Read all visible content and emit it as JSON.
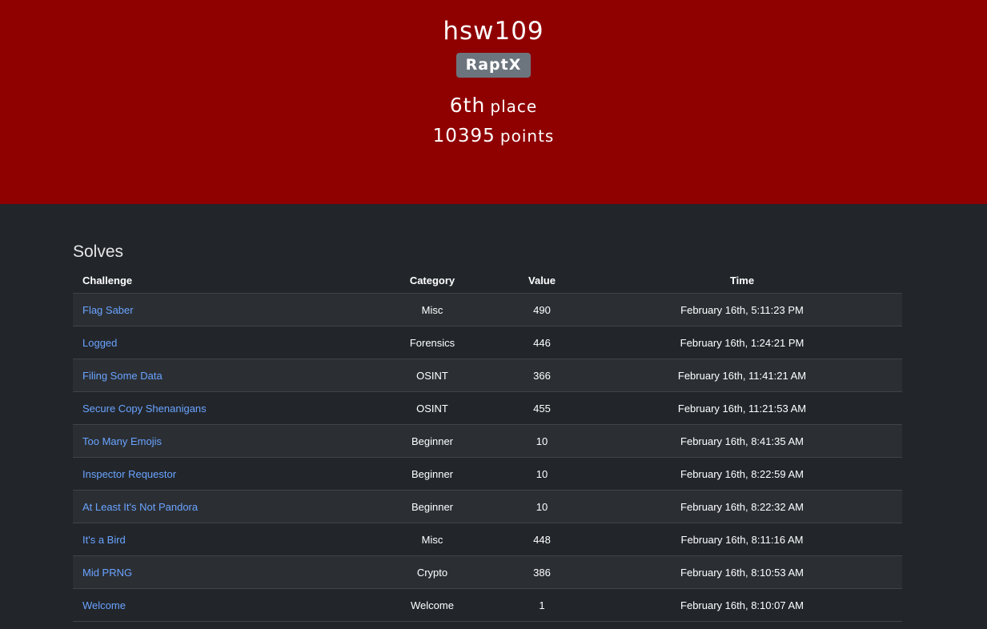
{
  "user": {
    "name": "hsw109",
    "team": "RaptX",
    "place_number": "6th",
    "place_label": "place",
    "points_number": "10395",
    "points_label": "points"
  },
  "solves": {
    "title": "Solves",
    "columns": [
      "Challenge",
      "Category",
      "Value",
      "Time"
    ],
    "rows": [
      {
        "challenge": "Flag Saber",
        "category": "Misc",
        "value": "490",
        "time": "February 16th, 5:11:23 PM"
      },
      {
        "challenge": "Logged",
        "category": "Forensics",
        "value": "446",
        "time": "February 16th, 1:24:21 PM"
      },
      {
        "challenge": "Filing Some Data",
        "category": "OSINT",
        "value": "366",
        "time": "February 16th, 11:41:21 AM"
      },
      {
        "challenge": "Secure Copy Shenanigans",
        "category": "OSINT",
        "value": "455",
        "time": "February 16th, 11:21:53 AM"
      },
      {
        "challenge": "Too Many Emojis",
        "category": "Beginner",
        "value": "10",
        "time": "February 16th, 8:41:35 AM"
      },
      {
        "challenge": "Inspector Requestor",
        "category": "Beginner",
        "value": "10",
        "time": "February 16th, 8:22:59 AM"
      },
      {
        "challenge": "At Least It's Not Pandora",
        "category": "Beginner",
        "value": "10",
        "time": "February 16th, 8:22:32 AM"
      },
      {
        "challenge": "It's a Bird",
        "category": "Misc",
        "value": "448",
        "time": "February 16th, 8:11:16 AM"
      },
      {
        "challenge": "Mid PRNG",
        "category": "Crypto",
        "value": "386",
        "time": "February 16th, 8:10:53 AM"
      },
      {
        "challenge": "Welcome",
        "category": "Welcome",
        "value": "1",
        "time": "February 16th, 8:10:07 AM"
      }
    ]
  },
  "colors": {
    "header_bg": "#8f0000",
    "page_bg": "#22262b",
    "link": "#6aa3ff",
    "badge_bg": "#6c757d"
  }
}
